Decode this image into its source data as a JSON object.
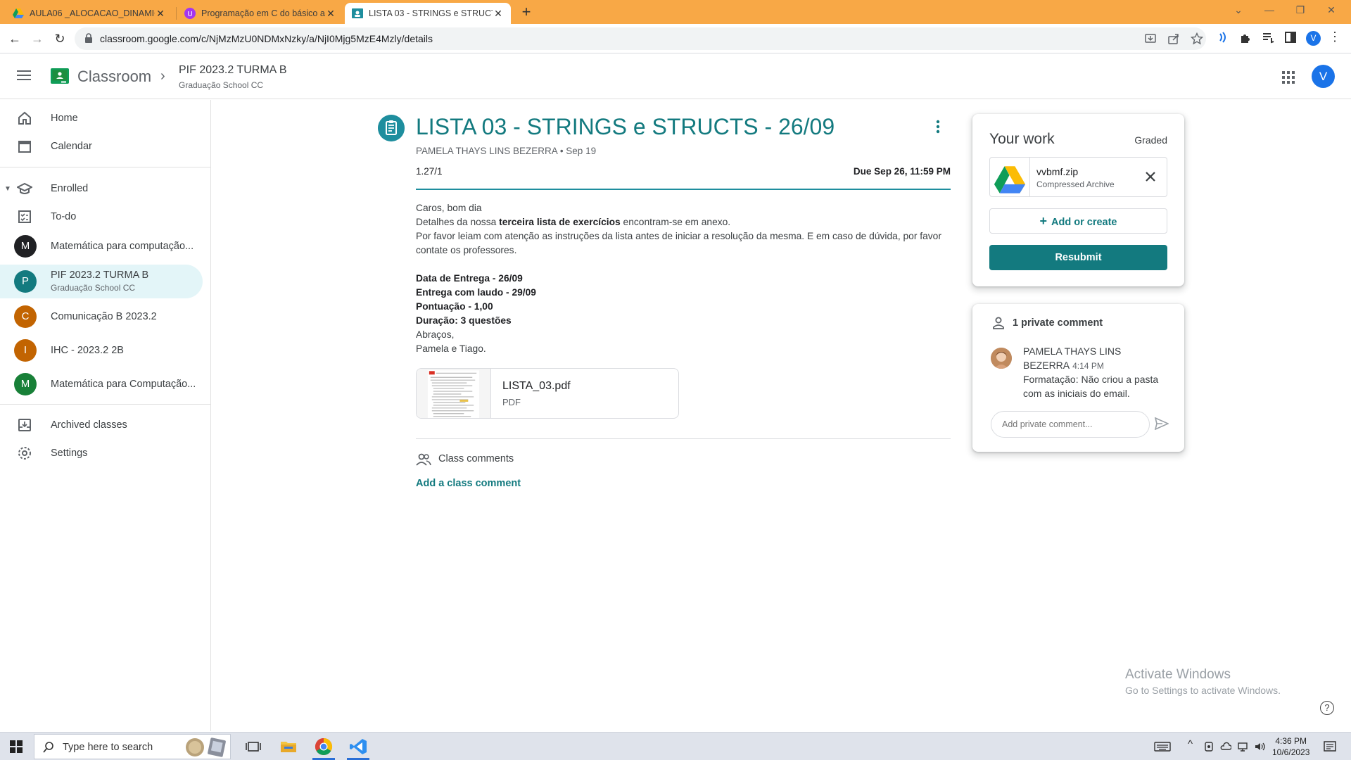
{
  "browser": {
    "tabs": [
      {
        "title": "AULA06 _ALOCACAO_DINAMIC",
        "favicon": "drive-icon"
      },
      {
        "title": "Programação em C do básico ao",
        "favicon": "udemy-icon"
      },
      {
        "title": "LISTA 03 - STRINGS e STRUCTS",
        "favicon": "classroom-icon",
        "active": true
      }
    ],
    "url": "classroom.google.com/c/NjMzMzU0NDMxNzky/a/NjI0Mjg5MzE4Mzly/details",
    "profile_initial": "V",
    "accent_color": "#f8a846"
  },
  "app": {
    "name": "Classroom",
    "course_title": "PIF 2023.2 TURMA B",
    "course_subtitle": "Graduação School CC",
    "user_initial": "V"
  },
  "sidebar": {
    "top": [
      {
        "label": "Home",
        "icon": "home-icon"
      },
      {
        "label": "Calendar",
        "icon": "calendar-icon"
      }
    ],
    "enrolled_label": "Enrolled",
    "todo_label": "To-do",
    "courses": [
      {
        "initial": "M",
        "label": "Matemática para computação...",
        "color": "#202124"
      },
      {
        "initial": "P",
        "label": "PIF 2023.2 TURMA B",
        "sub": "Graduação School CC",
        "color": "#137a7f",
        "selected": true
      },
      {
        "initial": "C",
        "label": "Comunicação B 2023.2",
        "color": "#c26401"
      },
      {
        "initial": "I",
        "label": "IHC - 2023.2 2B",
        "color": "#c26401"
      },
      {
        "initial": "M",
        "label": "Matemática para Computação...",
        "color": "#188038"
      }
    ],
    "bottom": [
      {
        "label": "Archived classes",
        "icon": "archive-icon"
      },
      {
        "label": "Settings",
        "icon": "gear-icon"
      }
    ]
  },
  "assignment": {
    "title": "LISTA 03 - STRINGS  e STRUCTS - 26/09",
    "author_line": "PAMELA THAYS LINS BEZERRA • Sep 19",
    "points": "1.27/1",
    "due": "Due Sep 26, 11:59 PM",
    "body": {
      "greeting": "Caros, bom dia",
      "details_pre": "Detalhes da nossa ",
      "details_bold": "terceira lista de exercícios",
      "details_post": " encontram-se em anexo.",
      "instructions": "Por favor leiam com atenção as instruções da lista antes de iniciar a resolução da mesma. E em caso de dúvida, por favor contate os professores.",
      "delivery": "Data de Entrega - 26/09",
      "late_delivery": "Entrega com laudo - 29/09",
      "score": "Pontuação - 1,00",
      "duration": "Duração: 3 questões",
      "closing": "Abraços,",
      "signature": "Pamela e Tiago."
    },
    "attachment": {
      "name": "LISTA_03.pdf",
      "type": "PDF"
    },
    "class_comments_label": "Class comments",
    "add_class_comment": "Add a class comment"
  },
  "work": {
    "title": "Your work",
    "status": "Graded",
    "file": {
      "name": "vvbmf.zip",
      "type": "Compressed Archive"
    },
    "add_create": "Add or create",
    "resubmit": "Resubmit"
  },
  "private_comments": {
    "header": "1 private comment",
    "author": "PAMELA THAYS LINS BEZERRA",
    "time": "4:14 PM",
    "text": "Formatação: Não criou a pasta com as iniciais do email.",
    "placeholder": "Add private comment..."
  },
  "watermark": {
    "line1": "Activate Windows",
    "line2": "Go to Settings to activate Windows."
  },
  "taskbar": {
    "search_placeholder": "Type here to search",
    "time": "4:36 PM",
    "date": "10/6/2023"
  }
}
